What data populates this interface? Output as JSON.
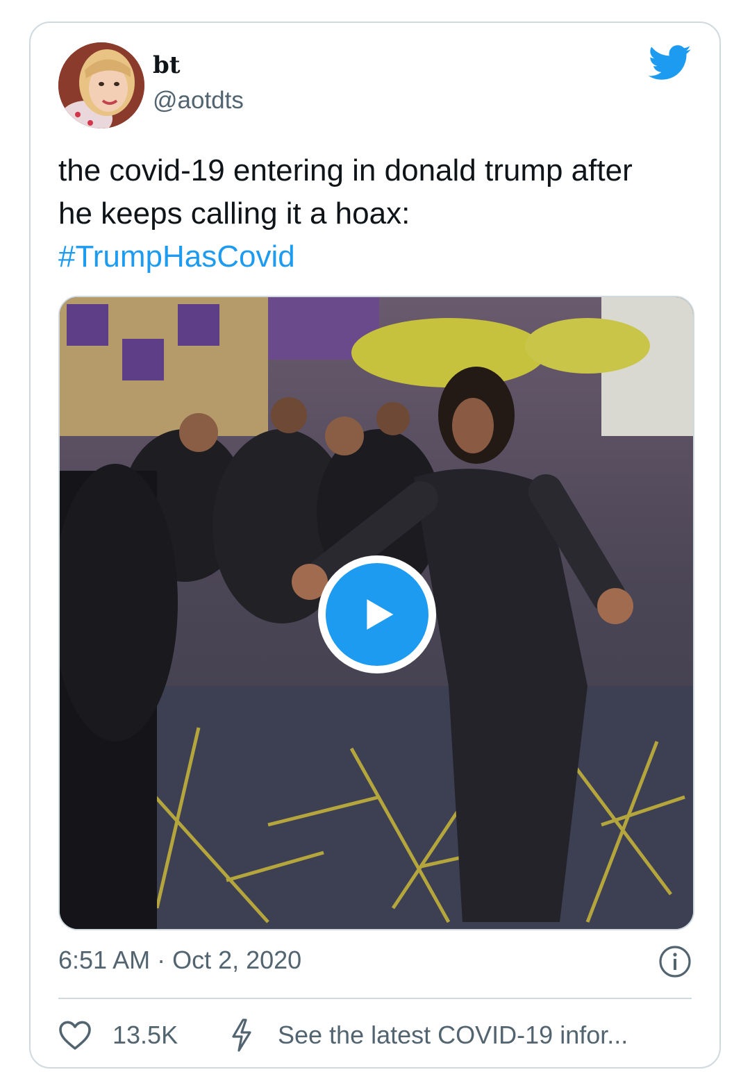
{
  "tweet": {
    "display_name": "bt",
    "handle": "@aotdts",
    "text_lines": [
      "the covid-19 entering in donald trump after",
      "he keeps calling it a hoax:"
    ],
    "hashtag": "#TrumpHasCovid",
    "timestamp": "6:51 AM · Oct 2, 2020"
  },
  "icons": {
    "logo": "twitter-bird-icon",
    "play": "play-icon",
    "info": "info-icon",
    "like": "heart-icon",
    "covid": "lightning-icon"
  },
  "actions": {
    "like_count": "13.5K",
    "covid_link": "See the latest COVID-19 infor..."
  },
  "colors": {
    "accent": "#1d9bf0",
    "text_primary": "#0f1419",
    "text_secondary": "#536471",
    "border": "#cfd9de"
  }
}
